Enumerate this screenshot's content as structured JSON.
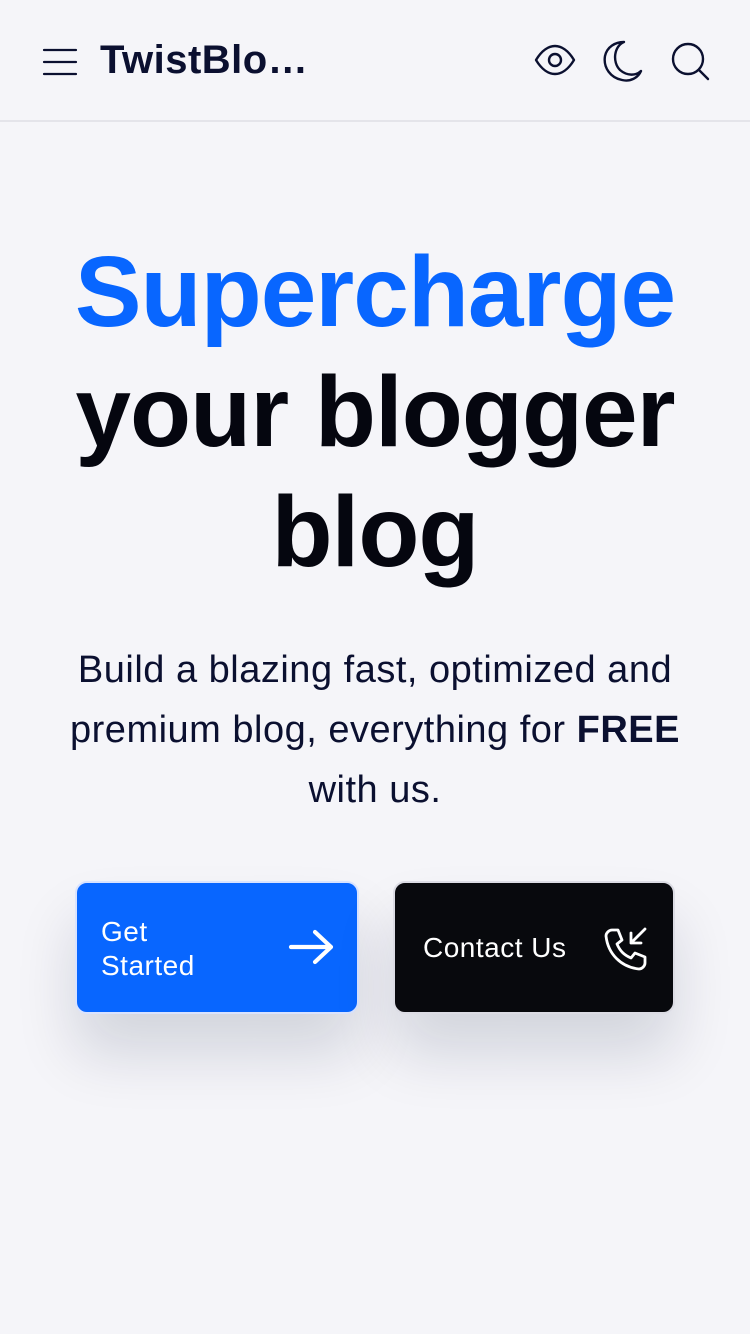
{
  "header": {
    "site_title": "TwistBlo…",
    "icons": [
      "menu-icon",
      "eye-icon",
      "moon-icon",
      "search-icon"
    ]
  },
  "hero": {
    "title_accent": "Supercharge",
    "title_line2": "your blogger",
    "title_line3": "blog",
    "subtitle_before": "Build a blazing fast, optimized and premium blog, everything for ",
    "subtitle_bold": "FREE",
    "subtitle_after": " with us."
  },
  "buttons": {
    "get_started": "Get Started",
    "contact_us": "Contact Us"
  },
  "colors": {
    "accent": "#0866ff",
    "dark_button": "#08090d",
    "background": "#f5f5f9"
  }
}
